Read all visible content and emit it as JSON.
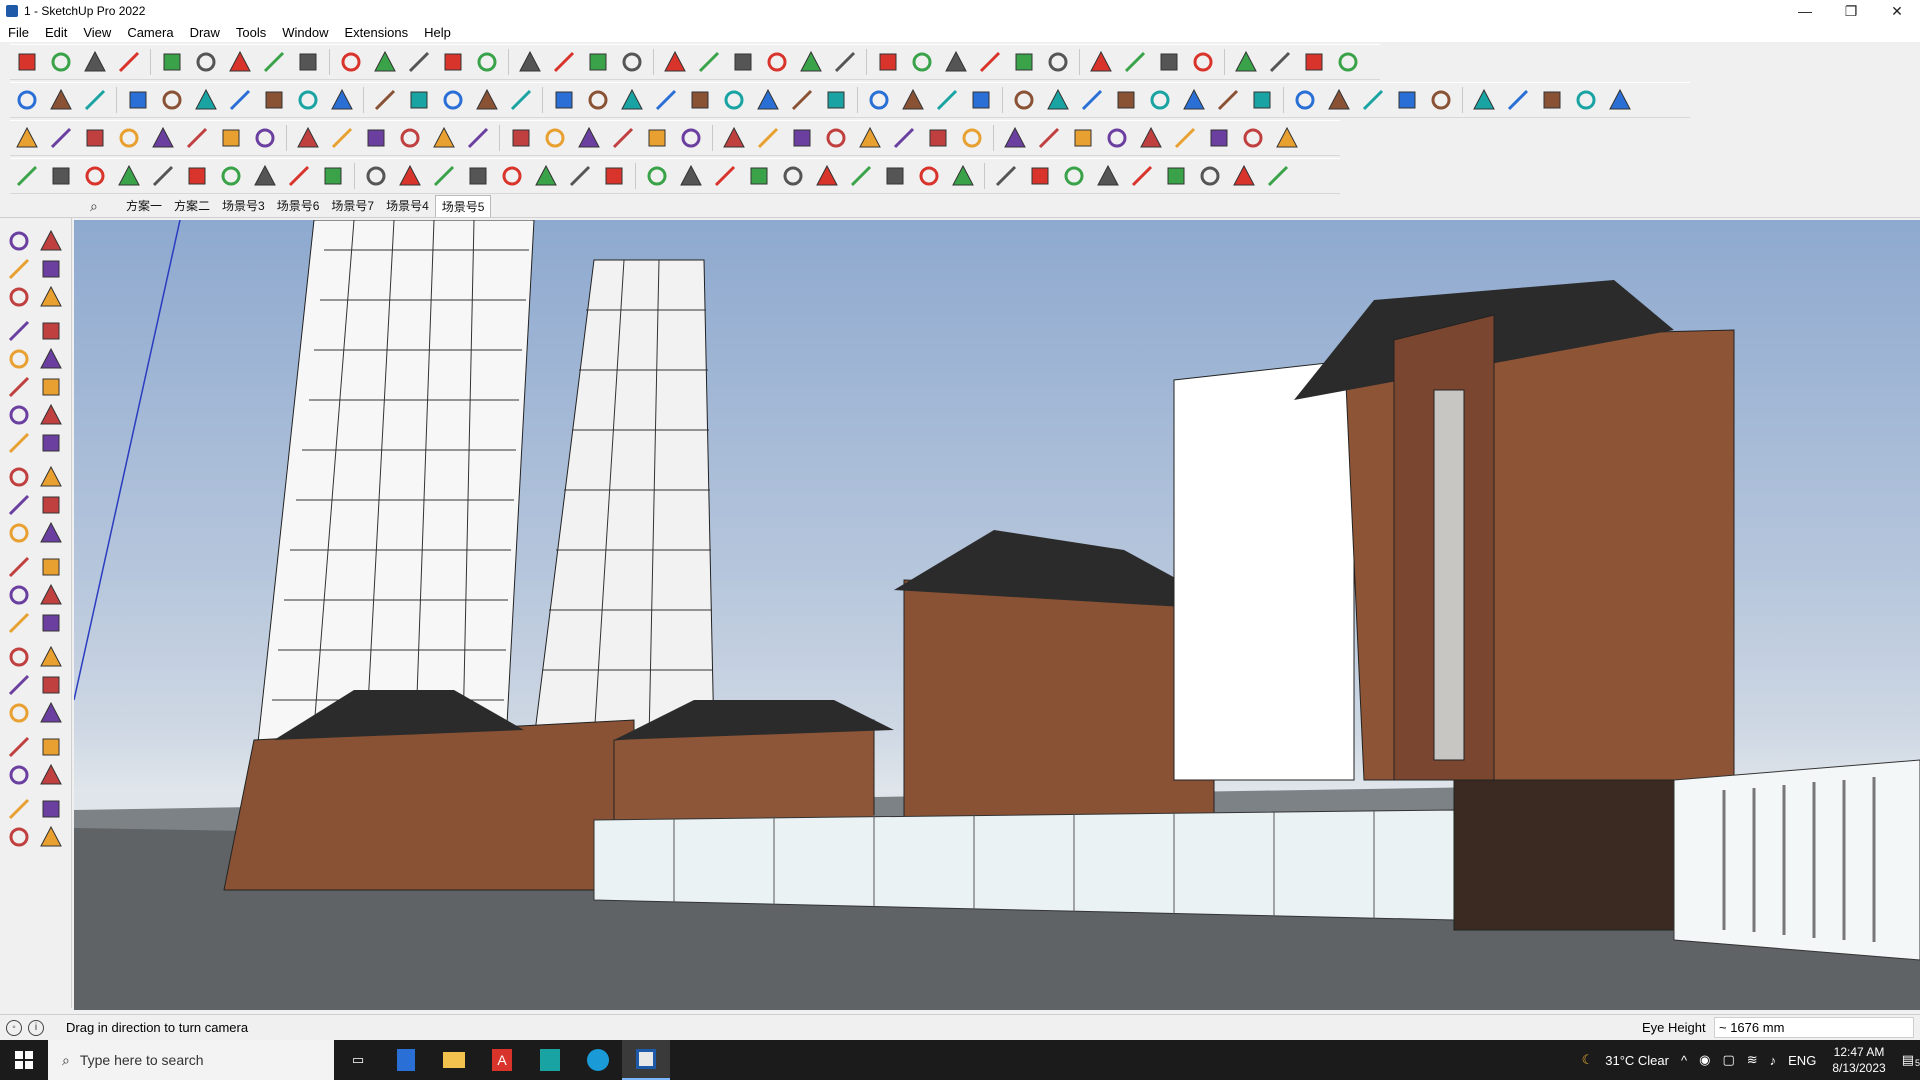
{
  "window": {
    "title": "1 - SketchUp Pro 2022",
    "minimize": "—",
    "maximize": "❐",
    "close": "✕"
  },
  "menu": [
    "File",
    "Edit",
    "View",
    "Camera",
    "Draw",
    "Tools",
    "Window",
    "Extensions",
    "Help"
  ],
  "scenes": {
    "tabs": [
      "方案一",
      "方案二",
      "场景号3",
      "场景号6",
      "场景号7",
      "场景号4",
      "场景号5"
    ],
    "active_index": 6
  },
  "status": {
    "hint": "Drag in direction to turn camera",
    "eye_label": "Eye Height",
    "eye_value": "~ 1676 mm"
  },
  "taskbar": {
    "search_placeholder": "Type here to search",
    "weather": "31°C  Clear",
    "language": "ENG",
    "time": "12:47 AM",
    "date": "8/13/2023",
    "notifications": "5"
  },
  "colors": {
    "accent_red": "#d9342b",
    "accent_blue": "#2a6fd6",
    "brick": "#8a5234",
    "roof": "#2b2b2b",
    "sky_top": "#8ea9cf"
  }
}
